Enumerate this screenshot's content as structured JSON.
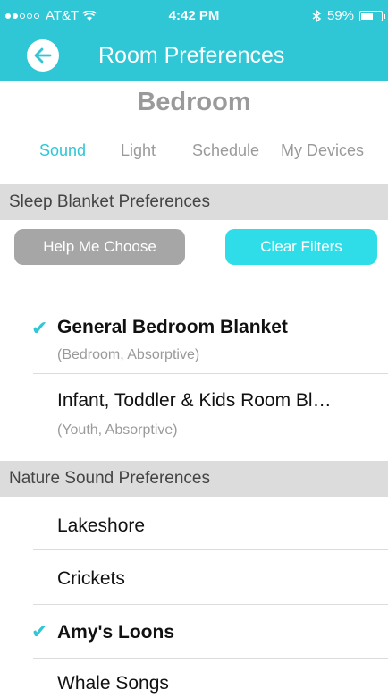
{
  "status": {
    "carrier": "AT&T",
    "time": "4:42 PM",
    "battery": "59%",
    "battery_level": 0.59
  },
  "header": {
    "title": "Room Preferences",
    "back_icon": "arrow-left-icon",
    "bg_color": "#2fc6d6"
  },
  "room": {
    "name": "Bedroom"
  },
  "tabs": [
    {
      "label": "Sound",
      "active": true
    },
    {
      "label": "Light",
      "active": false
    },
    {
      "label": "Schedule",
      "active": false
    },
    {
      "label": "My Devices",
      "active": false
    }
  ],
  "blanket": {
    "header": "Sleep Blanket Preferences",
    "help_button": "Help Me Choose",
    "clear_button": "Clear Filters",
    "items": [
      {
        "name": "General Bedroom Blanket",
        "details": "(Bedroom, Absorptive)",
        "checked": true
      },
      {
        "name": "Infant, Toddler & Kids Room Bl…",
        "details": "(Youth, Absorptive)",
        "checked": false
      }
    ]
  },
  "nature": {
    "header": "Nature Sound Preferences",
    "items": [
      {
        "name": "Lakeshore",
        "checked": false
      },
      {
        "name": "Crickets",
        "checked": false
      },
      {
        "name": "Amy's Loons",
        "checked": true
      },
      {
        "name": "Whale Songs",
        "checked": false
      }
    ]
  },
  "colors": {
    "accent": "#2fc6d6",
    "clear_button": "#2fdde9",
    "help_button": "#a6a6a6",
    "section_bg": "#dcdcdc"
  }
}
